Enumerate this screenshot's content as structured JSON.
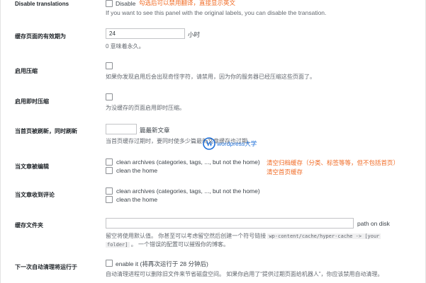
{
  "disable_translations": {
    "label": "Disable translations",
    "option": "Disable",
    "note": "勾选后可以禁用翻译，直接显示英文",
    "description": "If you want to see this panel with the original labels, you can disable the transation."
  },
  "cache_lifetime": {
    "label": "缓存页面的有效期为",
    "value": "24",
    "unit": "小时",
    "description": "0 意味着永久。"
  },
  "compression": {
    "label": "启用压缩",
    "description": "如果你发现启用后会出现奇怪字符，请禁用，因为你的服务器已经压缩这些页面了。"
  },
  "instant_compression": {
    "label": "启用即时压缩",
    "description": "为没缓存的页面启用即时压缩。"
  },
  "home_refresh": {
    "label": "当首页被刷新，同时刷新",
    "value": "",
    "unit": "篇最新文章",
    "description": "当首页缓存过期时，要同时使多少篇最新文章缓存也过期。"
  },
  "on_edit": {
    "label": "当文章被编辑",
    "option1": "clean archives (categories, tags, ..., but not the home)",
    "option2": "clean the home",
    "note1": "清空归档缓存（分类、标签等等，但不包括首页）",
    "note2": "清空首页缓存"
  },
  "on_comment": {
    "label": "当文章收到评论",
    "option1": "clean archives (categories, tags, ..., but not the home)",
    "option2": "clean the home"
  },
  "cache_folder": {
    "label": "缓存文件夹",
    "value": "",
    "suffix": "path on disk",
    "description_prefix": "留空将使用默认值。 你甚至可以考虑留空然后创建一个符号链接",
    "code": "wp-content/cache/hyper-cache -> [your",
    "code2": "folder]",
    "description_suffix": "。 一个错误的配置可以摧毁你的博客。"
  },
  "autoclean": {
    "label": "下一次自动清理将运行于",
    "option": "enable it (将再次运行于 28 分钟后)",
    "description": "自动清理进程可以删除旧文件来节省磁盘空间。 如果你启用了“提供过期页面给机器人”，你应该禁用自动清理。"
  },
  "watermark": {
    "text": "wordpress大学"
  },
  "colors": {
    "note": "#f06a23",
    "watermark": "#1e6fd8"
  }
}
